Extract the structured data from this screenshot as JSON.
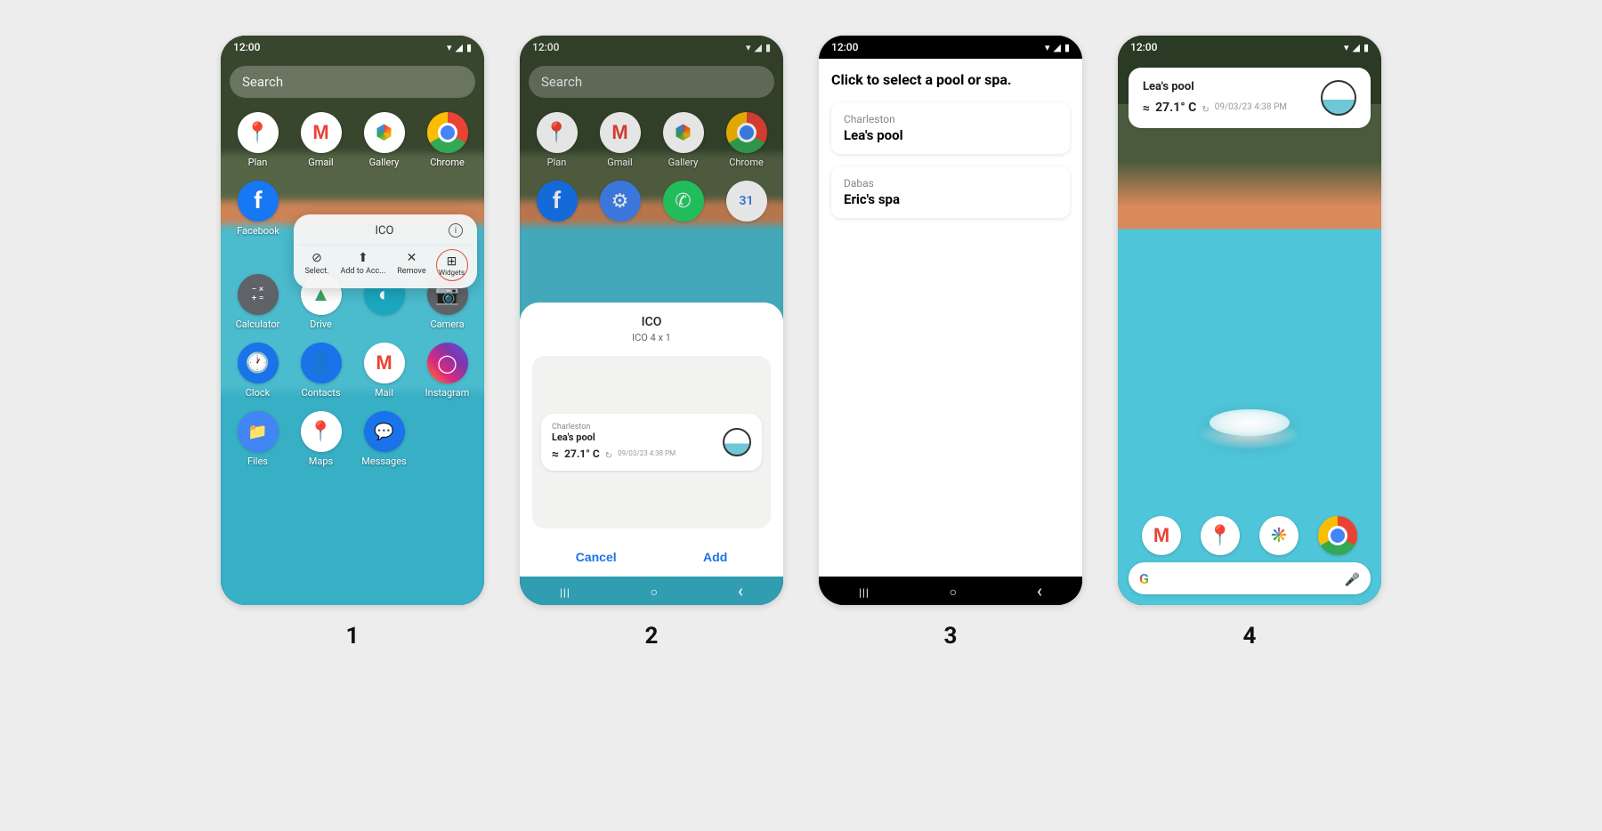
{
  "status": {
    "time": "12:00"
  },
  "step_labels": [
    "1",
    "2",
    "3",
    "4"
  ],
  "search_placeholder": "Search",
  "phone1": {
    "apps_row1": [
      {
        "label": "Plan",
        "icon": "gmaps"
      },
      {
        "label": "Gmail",
        "icon": "gmail"
      },
      {
        "label": "Gallery",
        "icon": "gallery"
      },
      {
        "label": "Chrome",
        "icon": "chrome"
      }
    ],
    "apps_row2_left": {
      "label": "Facebook",
      "icon": "facebook"
    },
    "apps_row3": [
      {
        "label": "Calculator",
        "icon": "calculator"
      },
      {
        "label": "Drive",
        "icon": "drive"
      },
      {
        "label": "",
        "icon": "ico"
      },
      {
        "label": "Camera",
        "icon": "camera"
      }
    ],
    "apps_row4": [
      {
        "label": "Clock",
        "icon": "clock"
      },
      {
        "label": "Contacts",
        "icon": "contacts"
      },
      {
        "label": "Mail",
        "icon": "gmail"
      },
      {
        "label": "Instagram",
        "icon": "instagram"
      }
    ],
    "apps_row5": [
      {
        "label": "Files",
        "icon": "files"
      },
      {
        "label": "Maps",
        "icon": "gmaps"
      },
      {
        "label": "Messages",
        "icon": "messages"
      }
    ],
    "popup": {
      "title": "ICO",
      "actions": [
        {
          "label": "Select.",
          "glyph": "✓"
        },
        {
          "label": "Add to Acc...",
          "glyph": "⬆"
        },
        {
          "label": "Remove",
          "glyph": "✕"
        },
        {
          "label": "Widgets",
          "glyph": "⊞"
        }
      ]
    }
  },
  "phone2": {
    "apps_row2": [
      {
        "label": "",
        "icon": "facebook"
      },
      {
        "label": "",
        "icon": "settings"
      },
      {
        "label": "",
        "icon": "whatsapp"
      },
      {
        "label": "",
        "icon": "calendar"
      }
    ],
    "sheet": {
      "title": "ICO",
      "subtitle": "ICO  4 x 1",
      "cancel": "Cancel",
      "add": "Add"
    },
    "preview": {
      "location": "Charleston",
      "name": "Lea's pool",
      "temp": "27.1° C",
      "timestamp": "09/03/23 4:38 PM"
    }
  },
  "phone3": {
    "title": "Click to select a pool or spa.",
    "options": [
      {
        "location": "Charleston",
        "name": "Lea's pool"
      },
      {
        "location": "Dabas",
        "name": "Eric's spa"
      }
    ]
  },
  "phone4": {
    "widget": {
      "name": "Lea's pool",
      "temp": "27.1° C",
      "timestamp": "09/03/23 4:38 PM"
    },
    "dock": [
      {
        "icon": "gmail"
      },
      {
        "icon": "gmaps"
      },
      {
        "icon": "photos"
      },
      {
        "icon": "chrome"
      }
    ]
  }
}
